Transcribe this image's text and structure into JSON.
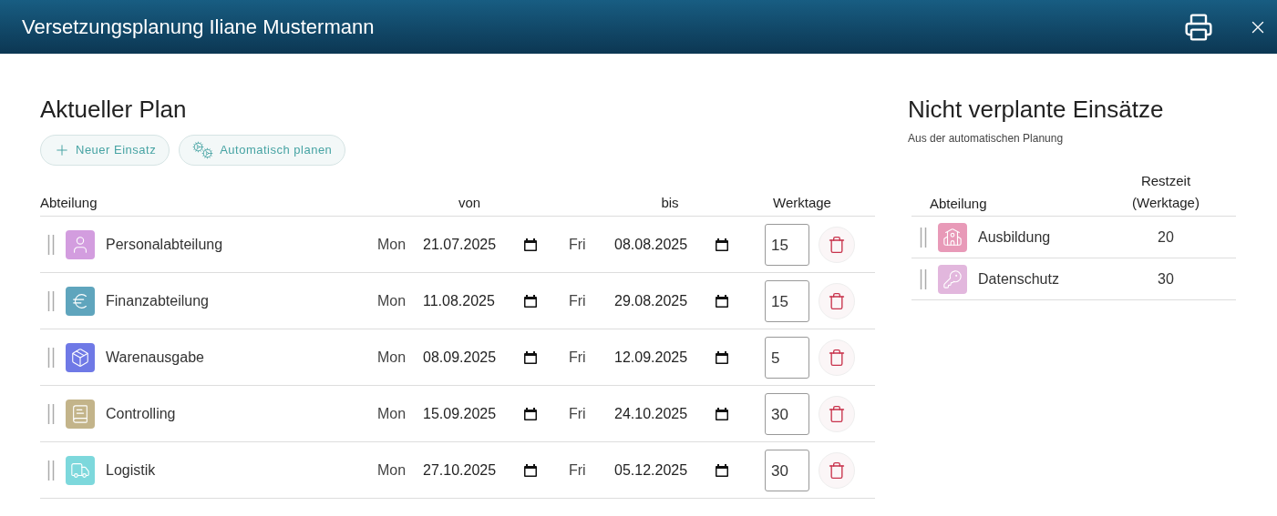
{
  "window": {
    "title": "Versetzungsplanung Iliane Mustermann"
  },
  "plan": {
    "title": "Aktueller Plan",
    "buttons": [
      {
        "kind": "add",
        "label": "Neuer Einsatz"
      },
      {
        "kind": "auto",
        "label": "Automatisch planen"
      }
    ],
    "columns": [
      "Abteilung",
      "von",
      "bis",
      "Werktage"
    ],
    "rows": [
      {
        "department": "Personalabteilung",
        "kind": "person",
        "color": "#d39ddf",
        "from_day": "Mon",
        "from": "21.07.2025",
        "to_day": "Fri",
        "to": "08.08.2025",
        "days": "15"
      },
      {
        "department": "Finanzabteilung",
        "kind": "euro",
        "color": "#5fa5bd",
        "from_day": "Mon",
        "from": "11.08.2025",
        "to_day": "Fri",
        "to": "29.08.2025",
        "days": "15"
      },
      {
        "department": "Warenausgabe",
        "kind": "box",
        "color": "#6f79e6",
        "from_day": "Mon",
        "from": "08.09.2025",
        "to_day": "Fri",
        "to": "12.09.2025",
        "days": "5"
      },
      {
        "department": "Controlling",
        "kind": "book",
        "color": "#c3b48a",
        "from_day": "Mon",
        "from": "15.09.2025",
        "to_day": "Fri",
        "to": "24.10.2025",
        "days": "30"
      },
      {
        "department": "Logistik",
        "kind": "truck",
        "color": "#7dd8dc",
        "from_day": "Mon",
        "from": "27.10.2025",
        "to_day": "Fri",
        "to": "05.12.2025",
        "days": "30"
      }
    ]
  },
  "unplanned": {
    "title": "Nicht verplante Einsätze",
    "subtitle": "Aus der automatischen Planung",
    "columns": [
      "Abteilung",
      "Restzeit (Werktage)"
    ],
    "rows": [
      {
        "department": "Ausbildung",
        "kind": "school",
        "color": "#e89ab8",
        "remaining": "20"
      },
      {
        "department": "Datenschutz",
        "kind": "key",
        "color": "#e2b7dd",
        "remaining": "30"
      }
    ]
  }
}
